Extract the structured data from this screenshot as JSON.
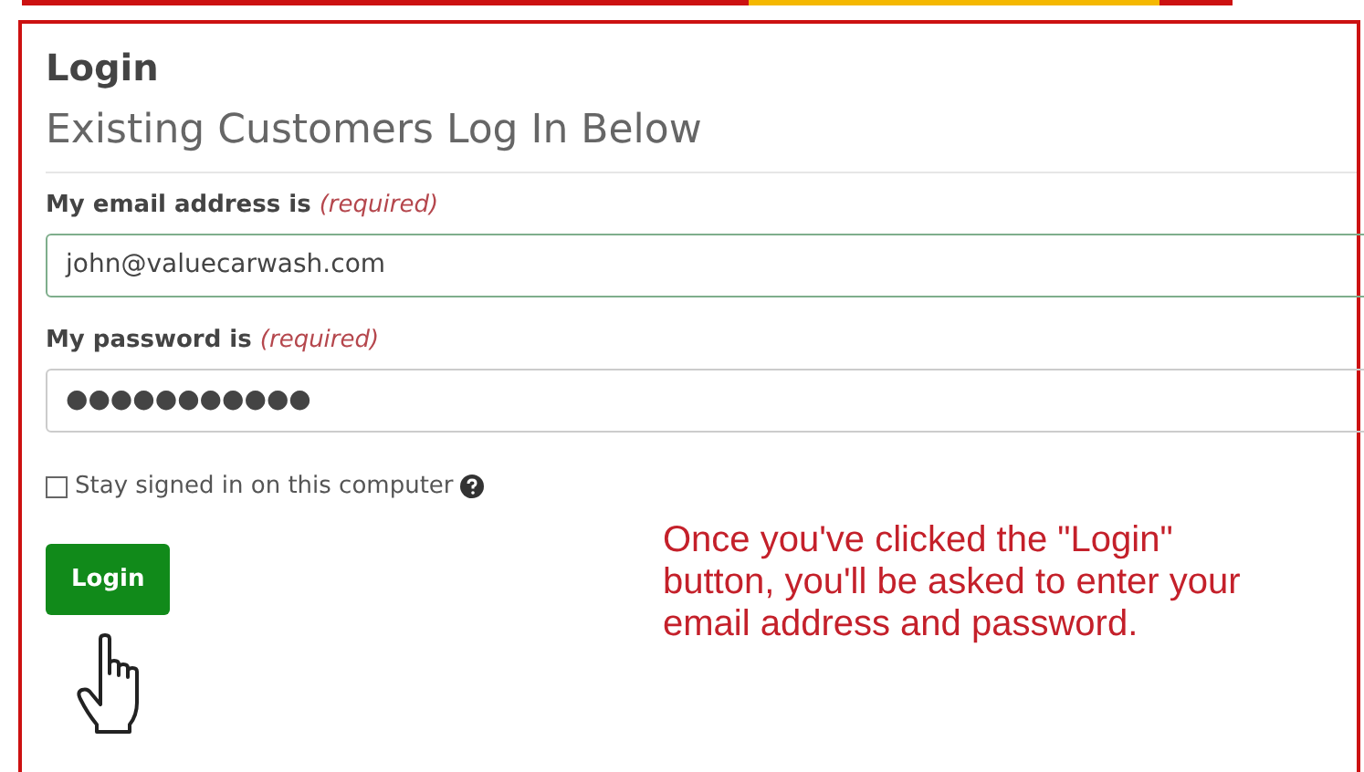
{
  "panel_title": "Login",
  "heading": "Existing Customers Log In Below",
  "email": {
    "label": "My email address is",
    "required": "(required)",
    "value": "john@valuecarwash.com",
    "focused": true
  },
  "password": {
    "label": "My password is",
    "required": "(required)",
    "value": "●●●●●●●●●●●",
    "focused": false
  },
  "stay_signed_in": {
    "label": "Stay signed in on this computer",
    "checked": false
  },
  "login_button": "Login",
  "callout": "Once you've clicked the \"Login\" button, you'll be asked to enter your email address and password."
}
